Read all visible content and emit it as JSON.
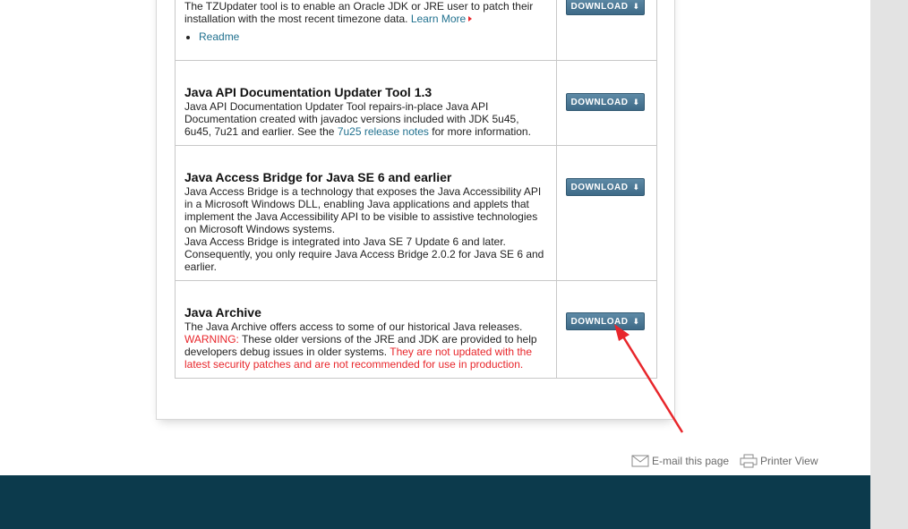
{
  "rows": [
    {
      "text1": "The TZUpdater tool is to enable an Oracle JDK or JRE user to patch their installation with the most recent timezone data.",
      "learn_more": "Learn More",
      "readme": "Readme",
      "button": "DOWNLOAD"
    },
    {
      "title": "Java API Documentation Updater Tool 1.3",
      "text1": "Java API Documentation Updater Tool repairs-in-place Java API Documentation created with javadoc versions included with JDK 5u45, 6u45, 7u21 and earlier.  See the",
      "link": "7u25 release notes",
      "text2": "for more information.",
      "button": "DOWNLOAD"
    },
    {
      "title": "Java Access Bridge for Java SE 6 and earlier",
      "text1": "Java Access Bridge is a technology that exposes the Java Accessibility API in a Microsoft Windows DLL, enabling Java applications and applets that implement the Java Accessibility API to be visible to assistive technologies on Microsoft Windows systems.",
      "text2": "Java Access Bridge is integrated into Java SE 7 Update 6 and later. Consequently, you only require Java Access Bridge 2.0.2 for Java SE 6 and earlier.",
      "button": "DOWNLOAD"
    },
    {
      "title": "Java Archive",
      "text1": "The Java Archive offers access to some of our historical Java releases.",
      "warning_label": "WARNING:",
      "warning_text": "These older versions of the JRE and JDK are provided to help developers debug issues in older systems.",
      "warning_red": "They are not updated with the latest security patches and are not recommended for use in production.",
      "button": "DOWNLOAD"
    }
  ],
  "footer": {
    "email": "E-mail this page",
    "print": "Printer View"
  },
  "colors": {
    "link": "#21718f",
    "warning": "#e8262b",
    "button": "#4a7593",
    "footer_bar": "#0c3a4c",
    "annotation_arrow": "#e8262b"
  },
  "icons": {
    "download": "download-icon",
    "email": "envelope-icon",
    "print": "printer-icon",
    "learn_more": "triangle-right-icon"
  }
}
